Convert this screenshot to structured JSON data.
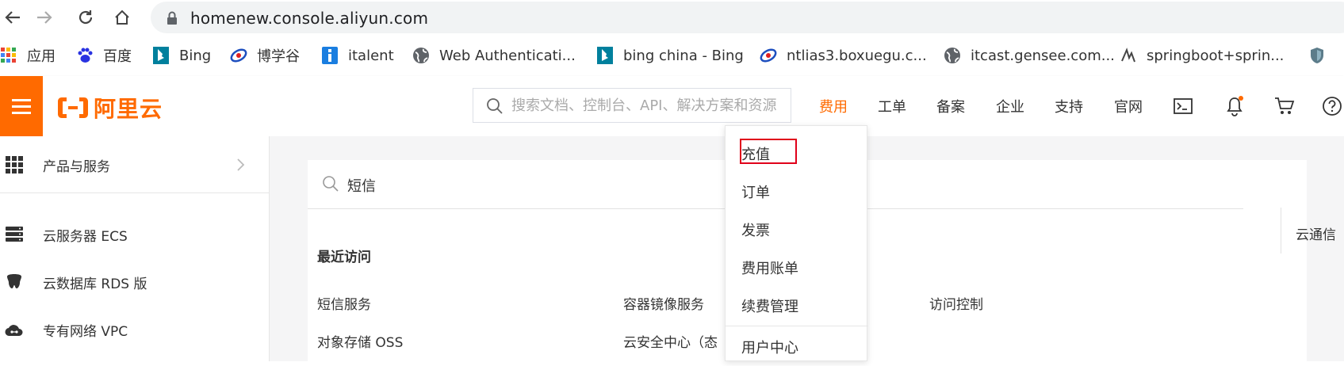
{
  "browser": {
    "url": "homenew.console.aliyun.com",
    "bookmarks": [
      {
        "label": "应用",
        "icon": "apps-grid-icon"
      },
      {
        "label": "百度",
        "icon": "baidu-paw-icon"
      },
      {
        "label": "Bing",
        "icon": "bing-icon"
      },
      {
        "label": "博学谷",
        "icon": "boxuegu-icon"
      },
      {
        "label": "italent",
        "icon": "italent-icon"
      },
      {
        "label": "Web Authenticati...",
        "icon": "globe-icon"
      },
      {
        "label": "bing china - Bing",
        "icon": "bing-icon"
      },
      {
        "label": "ntlias3.boxuegu.c...",
        "icon": "boxuegu-icon"
      },
      {
        "label": "itcast.gensee.com...",
        "icon": "globe-icon"
      },
      {
        "label": "springboot+sprin...",
        "icon": "script-icon"
      }
    ]
  },
  "header": {
    "logo_text": "阿里云",
    "search_placeholder": "搜索文档、控制台、API、解决方案和资源",
    "nav": [
      "费用",
      "工单",
      "备案",
      "企业",
      "支持",
      "官网"
    ],
    "active_nav": "费用",
    "accent_color": "#ff6a00"
  },
  "sidebar": {
    "head_label": "产品与服务",
    "items": [
      {
        "label": "云服务器 ECS",
        "icon": "server-icon"
      },
      {
        "label": "云数据库 RDS 版",
        "icon": "database-icon"
      },
      {
        "label": "专有网络 VPC",
        "icon": "cloud-network-icon"
      }
    ]
  },
  "main": {
    "search_value": "短信",
    "right_tab": "云通信",
    "recent_title": "最近访问",
    "recent_links": [
      "短信服务",
      "容器镜像服务",
      "访问控制",
      "对象存储 OSS",
      "云安全中心（态"
    ]
  },
  "dropdown": {
    "items": [
      "充值",
      "订单",
      "发票",
      "费用账单",
      "续费管理",
      "用户中心"
    ],
    "highlighted": "充值",
    "highlight_color": "#e0001a"
  }
}
